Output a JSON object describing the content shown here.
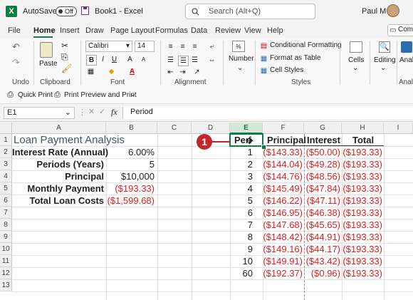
{
  "titlebar": {
    "autosave_label": "AutoSave",
    "autosave_state": "Off",
    "filename": "Book1 - Excel",
    "search_placeholder": "Search (Alt+Q)",
    "user": "Paul M"
  },
  "ribbon": {
    "tabs": [
      "File",
      "Home",
      "Insert",
      "Draw",
      "Page Layout",
      "Formulas",
      "Data",
      "Review",
      "View",
      "Help"
    ],
    "active_tab": "Home",
    "comments_label": "Com",
    "font_name": "Calibri",
    "font_size": "14",
    "groups": {
      "undo": "Undo",
      "clipboard": "Clipboard",
      "font": "Font",
      "alignment": "Alignment",
      "styles": "Styles",
      "cells": "Cells",
      "editing": "Editing",
      "analysis": "Analy"
    },
    "paste": "Paste",
    "number": "Number",
    "cells_btn": "Cells",
    "editing_btn": "Editing",
    "analyze_btn": "Anal",
    "conditional_formatting": "Conditional Formatting",
    "format_as_table": "Format as Table",
    "cell_styles": "Cell Styles"
  },
  "qat": {
    "quick_print": "Quick Print",
    "print_preview": "Print Preview and Print"
  },
  "formula_bar": {
    "name_box": "E1",
    "fx": "fx",
    "content": "Period"
  },
  "sheet": {
    "columns": [
      "A",
      "B",
      "C",
      "D",
      "E",
      "F",
      "G",
      "H",
      "I"
    ],
    "rows": [
      "1",
      "2",
      "3",
      "4",
      "5",
      "6",
      "7",
      "8",
      "9",
      "10",
      "11",
      "12",
      "13"
    ],
    "title": "Loan Payment Analysis",
    "labels": [
      "Interest Rate (Annual)",
      "Periods (Years)",
      "Principal",
      "Monthly Payment",
      "Total Loan Costs"
    ],
    "values": [
      "6.00%",
      "5",
      "$10,000",
      "($193.33)",
      "($1,599.68)"
    ],
    "headers": {
      "period": "Peri",
      "principal": "Principal",
      "interest": "Interest",
      "total": "Total"
    },
    "table": [
      {
        "period": "1",
        "principal": "($143.33)",
        "interest": "($50.00)",
        "total": "($193.33)"
      },
      {
        "period": "2",
        "principal": "($144.04)",
        "interest": "($49.28)",
        "total": "($193.33)"
      },
      {
        "period": "3",
        "principal": "($144.76)",
        "interest": "($48.56)",
        "total": "($193.33)"
      },
      {
        "period": "4",
        "principal": "($145.49)",
        "interest": "($47.84)",
        "total": "($193.33)"
      },
      {
        "period": "5",
        "principal": "($146.22)",
        "interest": "($47.11)",
        "total": "($193.33)"
      },
      {
        "period": "6",
        "principal": "($146.95)",
        "interest": "($46.38)",
        "total": "($193.33)"
      },
      {
        "period": "7",
        "principal": "($147.68)",
        "interest": "($45.65)",
        "total": "($193.33)"
      },
      {
        "period": "8",
        "principal": "($148.42)",
        "interest": "($44.91)",
        "total": "($193.33)"
      },
      {
        "period": "9",
        "principal": "($149.16)",
        "interest": "($44.17)",
        "total": "($193.33)"
      },
      {
        "period": "10",
        "principal": "($149.91)",
        "interest": "($43.42)",
        "total": "($193.33)"
      },
      {
        "period": "60",
        "principal": "($192.37)",
        "interest": "($0.96)",
        "total": "($193.33)"
      }
    ]
  },
  "callout": {
    "number": "1",
    "color": "#c1272d"
  },
  "colors": {
    "excel_green": "#107c41",
    "negative_red": "#e02020",
    "title_blue": "#44546a"
  }
}
